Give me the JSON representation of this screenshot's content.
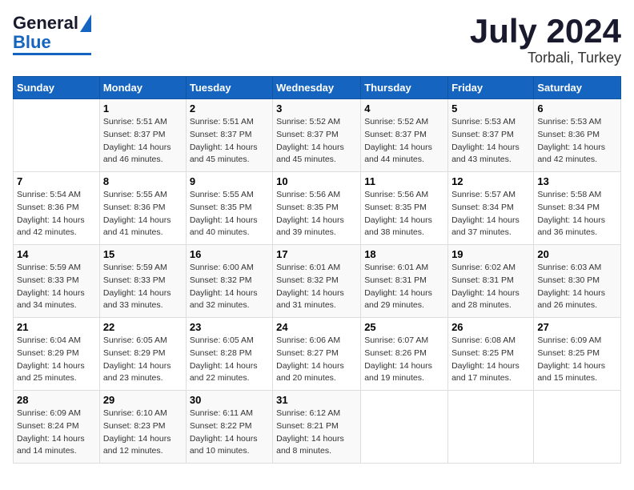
{
  "header": {
    "logo_line1": "General",
    "logo_line2": "Blue",
    "title": "July 2024",
    "subtitle": "Torbali, Turkey"
  },
  "weekdays": [
    "Sunday",
    "Monday",
    "Tuesday",
    "Wednesday",
    "Thursday",
    "Friday",
    "Saturday"
  ],
  "weeks": [
    [
      {
        "day": "",
        "info": ""
      },
      {
        "day": "1",
        "info": "Sunrise: 5:51 AM\nSunset: 8:37 PM\nDaylight: 14 hours\nand 46 minutes."
      },
      {
        "day": "2",
        "info": "Sunrise: 5:51 AM\nSunset: 8:37 PM\nDaylight: 14 hours\nand 45 minutes."
      },
      {
        "day": "3",
        "info": "Sunrise: 5:52 AM\nSunset: 8:37 PM\nDaylight: 14 hours\nand 45 minutes."
      },
      {
        "day": "4",
        "info": "Sunrise: 5:52 AM\nSunset: 8:37 PM\nDaylight: 14 hours\nand 44 minutes."
      },
      {
        "day": "5",
        "info": "Sunrise: 5:53 AM\nSunset: 8:37 PM\nDaylight: 14 hours\nand 43 minutes."
      },
      {
        "day": "6",
        "info": "Sunrise: 5:53 AM\nSunset: 8:36 PM\nDaylight: 14 hours\nand 42 minutes."
      }
    ],
    [
      {
        "day": "7",
        "info": "Sunrise: 5:54 AM\nSunset: 8:36 PM\nDaylight: 14 hours\nand 42 minutes."
      },
      {
        "day": "8",
        "info": "Sunrise: 5:55 AM\nSunset: 8:36 PM\nDaylight: 14 hours\nand 41 minutes."
      },
      {
        "day": "9",
        "info": "Sunrise: 5:55 AM\nSunset: 8:35 PM\nDaylight: 14 hours\nand 40 minutes."
      },
      {
        "day": "10",
        "info": "Sunrise: 5:56 AM\nSunset: 8:35 PM\nDaylight: 14 hours\nand 39 minutes."
      },
      {
        "day": "11",
        "info": "Sunrise: 5:56 AM\nSunset: 8:35 PM\nDaylight: 14 hours\nand 38 minutes."
      },
      {
        "day": "12",
        "info": "Sunrise: 5:57 AM\nSunset: 8:34 PM\nDaylight: 14 hours\nand 37 minutes."
      },
      {
        "day": "13",
        "info": "Sunrise: 5:58 AM\nSunset: 8:34 PM\nDaylight: 14 hours\nand 36 minutes."
      }
    ],
    [
      {
        "day": "14",
        "info": "Sunrise: 5:59 AM\nSunset: 8:33 PM\nDaylight: 14 hours\nand 34 minutes."
      },
      {
        "day": "15",
        "info": "Sunrise: 5:59 AM\nSunset: 8:33 PM\nDaylight: 14 hours\nand 33 minutes."
      },
      {
        "day": "16",
        "info": "Sunrise: 6:00 AM\nSunset: 8:32 PM\nDaylight: 14 hours\nand 32 minutes."
      },
      {
        "day": "17",
        "info": "Sunrise: 6:01 AM\nSunset: 8:32 PM\nDaylight: 14 hours\nand 31 minutes."
      },
      {
        "day": "18",
        "info": "Sunrise: 6:01 AM\nSunset: 8:31 PM\nDaylight: 14 hours\nand 29 minutes."
      },
      {
        "day": "19",
        "info": "Sunrise: 6:02 AM\nSunset: 8:31 PM\nDaylight: 14 hours\nand 28 minutes."
      },
      {
        "day": "20",
        "info": "Sunrise: 6:03 AM\nSunset: 8:30 PM\nDaylight: 14 hours\nand 26 minutes."
      }
    ],
    [
      {
        "day": "21",
        "info": "Sunrise: 6:04 AM\nSunset: 8:29 PM\nDaylight: 14 hours\nand 25 minutes."
      },
      {
        "day": "22",
        "info": "Sunrise: 6:05 AM\nSunset: 8:29 PM\nDaylight: 14 hours\nand 23 minutes."
      },
      {
        "day": "23",
        "info": "Sunrise: 6:05 AM\nSunset: 8:28 PM\nDaylight: 14 hours\nand 22 minutes."
      },
      {
        "day": "24",
        "info": "Sunrise: 6:06 AM\nSunset: 8:27 PM\nDaylight: 14 hours\nand 20 minutes."
      },
      {
        "day": "25",
        "info": "Sunrise: 6:07 AM\nSunset: 8:26 PM\nDaylight: 14 hours\nand 19 minutes."
      },
      {
        "day": "26",
        "info": "Sunrise: 6:08 AM\nSunset: 8:25 PM\nDaylight: 14 hours\nand 17 minutes."
      },
      {
        "day": "27",
        "info": "Sunrise: 6:09 AM\nSunset: 8:25 PM\nDaylight: 14 hours\nand 15 minutes."
      }
    ],
    [
      {
        "day": "28",
        "info": "Sunrise: 6:09 AM\nSunset: 8:24 PM\nDaylight: 14 hours\nand 14 minutes."
      },
      {
        "day": "29",
        "info": "Sunrise: 6:10 AM\nSunset: 8:23 PM\nDaylight: 14 hours\nand 12 minutes."
      },
      {
        "day": "30",
        "info": "Sunrise: 6:11 AM\nSunset: 8:22 PM\nDaylight: 14 hours\nand 10 minutes."
      },
      {
        "day": "31",
        "info": "Sunrise: 6:12 AM\nSunset: 8:21 PM\nDaylight: 14 hours\nand 8 minutes."
      },
      {
        "day": "",
        "info": ""
      },
      {
        "day": "",
        "info": ""
      },
      {
        "day": "",
        "info": ""
      }
    ]
  ]
}
